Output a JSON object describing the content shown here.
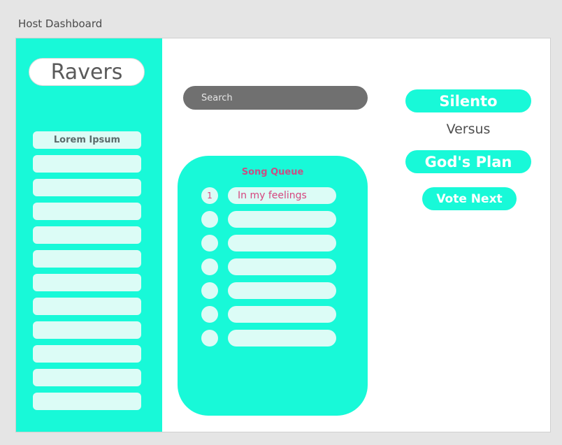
{
  "window": {
    "title": "Host Dashboard"
  },
  "sidebar": {
    "brand": "Ravers",
    "items": [
      {
        "label": "Lorem Ipsum"
      },
      {
        "label": ""
      },
      {
        "label": ""
      },
      {
        "label": ""
      },
      {
        "label": ""
      },
      {
        "label": ""
      },
      {
        "label": ""
      },
      {
        "label": ""
      },
      {
        "label": ""
      },
      {
        "label": ""
      },
      {
        "label": ""
      },
      {
        "label": ""
      }
    ]
  },
  "search": {
    "placeholder": "Search"
  },
  "queue": {
    "title": "Song Queue",
    "items": [
      {
        "num": "1",
        "song": "In my feelings"
      },
      {
        "num": "",
        "song": ""
      },
      {
        "num": "",
        "song": ""
      },
      {
        "num": "",
        "song": ""
      },
      {
        "num": "",
        "song": ""
      },
      {
        "num": "",
        "song": ""
      },
      {
        "num": "",
        "song": ""
      }
    ]
  },
  "vote": {
    "option_a": "Silento",
    "versus": "Versus",
    "option_b": "God's Plan",
    "vote_label": "Vote Next"
  },
  "colors": {
    "accent": "#18f9d8",
    "pill_bg": "#dcfcf6",
    "queue_text": "#d6447d",
    "search_bg": "#707070"
  }
}
